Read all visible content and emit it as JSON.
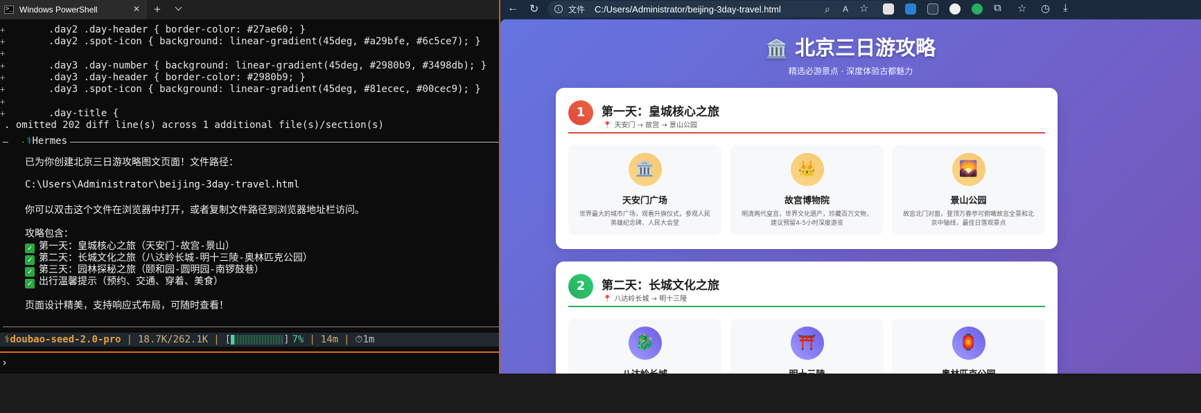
{
  "terminal": {
    "tab_title": "Windows PowerShell",
    "diff_lines": [
      {
        "gutter": "+",
        "code": ".day2 .day-header { border-color: #27ae60; }"
      },
      {
        "gutter": "+",
        "code": ".day2 .spot-icon { background: linear-gradient(45deg, #a29bfe, #6c5ce7); }"
      },
      {
        "gutter": "+",
        "code": ""
      },
      {
        "gutter": "+",
        "code": ".day3 .day-number { background: linear-gradient(45deg, #2980b9, #3498db); }"
      },
      {
        "gutter": "+",
        "code": ".day3 .day-header { border-color: #2980b9; }"
      },
      {
        "gutter": "+",
        "code": ".day3 .spot-icon { background: linear-gradient(45deg, #81ecec, #00cec9); }"
      },
      {
        "gutter": "+",
        "code": ""
      },
      {
        "gutter": "+",
        "code": ".day-title {"
      }
    ],
    "omitted_note": ". omitted 202 diff line(s) across 1 additional file(s)/section(s)",
    "agent_name": "Hermes",
    "response": {
      "intro": "已为你创建北京三日游攻略图文页面！文件路径：",
      "path": "C:\\Users\\Administrator\\beijing-3day-travel.html",
      "open_hint": "你可以双击这个文件在浏览器中打开，或者复制文件路径到浏览器地址栏访问。",
      "contents_label": "攻略包含：",
      "items": [
        "第一天：皇城核心之旅（天安门-故宫-景山）",
        "第二天：长城文化之旅（八达岭长城-明十三陵-奥林匹克公园）",
        "第三天：园林探秘之旅（颐和园-圆明园-南锣鼓巷）",
        "出行温馨提示（预约、交通、穿着、美食）"
      ],
      "closing": "页面设计精美，支持响应式布局，可随时查看！"
    },
    "status": {
      "model": "doubao-seed-2.0-pro",
      "tokens": "18.7K/262.1K",
      "context_percent": "7%",
      "context_fraction": 0.07,
      "duration": "14m",
      "elapsed": "1m"
    },
    "prompt": "›"
  },
  "browser": {
    "url_scheme": "文件",
    "url": "C:/Users/Administrator/beijing-3day-travel.html",
    "page": {
      "title": "北京三日游攻略",
      "title_icon": "🏛️",
      "subtitle": "精选必游景点 · 深度体验古都魅力",
      "days": [
        {
          "number": "1",
          "title": "第一天：皇城核心之旅",
          "route": "天安门 → 故宫 → 景山公园",
          "accent": "#e0463a",
          "spots": [
            {
              "icon": "🏛️",
              "name": "天安门广场",
              "desc": "世界最大的城市广场，观看升旗仪式，参观人民英雄纪念碑、人民大会堂"
            },
            {
              "icon": "👑",
              "name": "故宫博物院",
              "desc": "明清两代皇宫，世界文化遗产，珍藏百万文物，建议预留4-5小时深度游览"
            },
            {
              "icon": "🌄",
              "name": "景山公园",
              "desc": "故宫北门对面，登顶万春亭可俯瞰故宫全景和北京中轴线，最佳日落观景点"
            }
          ]
        },
        {
          "number": "2",
          "title": "第二天：长城文化之旅",
          "route": "八达岭长城 → 明十三陵",
          "accent": "#27ae60",
          "spots": [
            {
              "icon": "🐉",
              "name": "八达岭长城",
              "desc": ""
            },
            {
              "icon": "⛩️",
              "name": "明十三陵",
              "desc": ""
            },
            {
              "icon": "🏮",
              "name": "奥林匹克公园",
              "desc": ""
            }
          ]
        }
      ]
    }
  }
}
